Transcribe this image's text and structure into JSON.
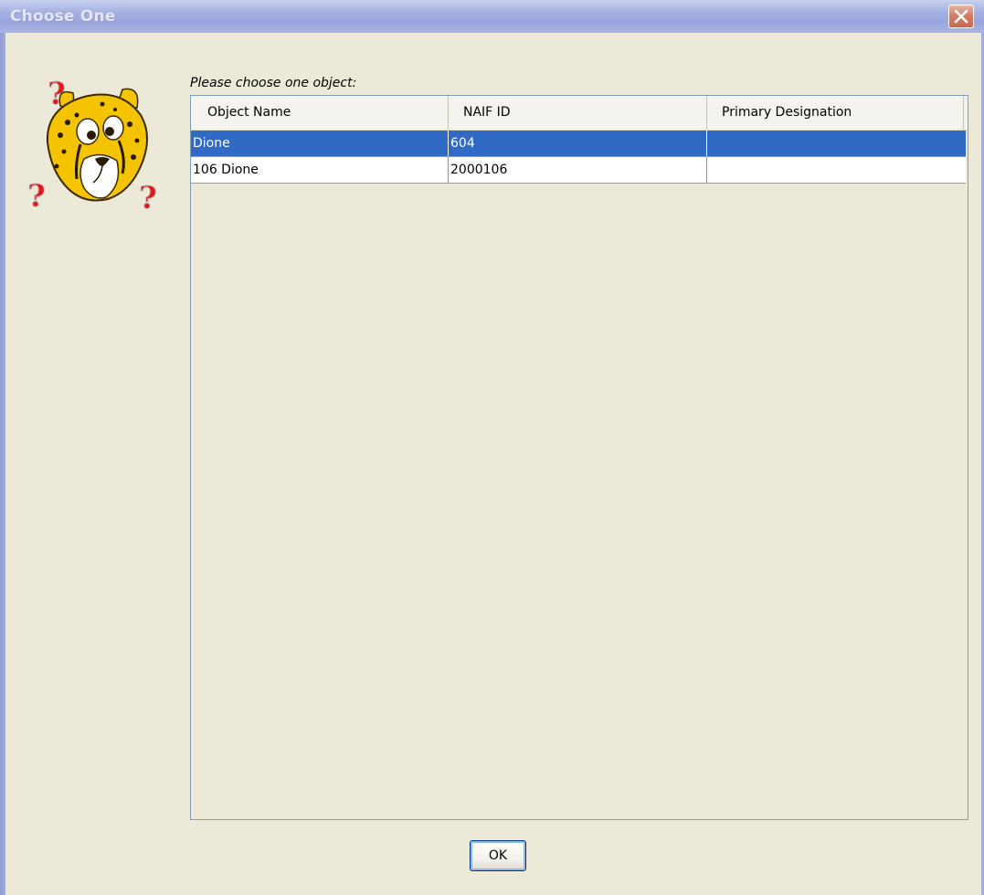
{
  "window": {
    "title": "Choose One",
    "close_icon": "close-x-icon"
  },
  "dialog": {
    "icon": "confused-cheetah-with-question-marks",
    "prompt": "Please choose one object:"
  },
  "table": {
    "columns": [
      "Object Name",
      "NAIF ID",
      "Primary Designation"
    ],
    "rows": [
      {
        "object_name": "Dione",
        "naif_id": "604",
        "primary_designation": "",
        "selected": true
      },
      {
        "object_name": "106 Dione",
        "naif_id": "2000106",
        "primary_designation": "",
        "selected": false
      }
    ]
  },
  "buttons": {
    "ok_label": "OK"
  },
  "colors": {
    "selection": "#316ac5",
    "dialog_background": "#ece9d8",
    "title_bar": "#a7b2e2",
    "close_button": "#d47f66"
  }
}
